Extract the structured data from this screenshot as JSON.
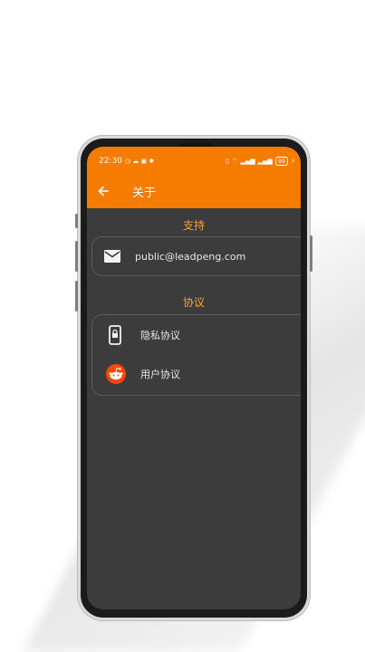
{
  "status_bar": {
    "time": "22:30",
    "battery": "99"
  },
  "toolbar": {
    "title": "关于",
    "back_icon": "arrow-left-icon"
  },
  "sections": [
    {
      "header": "支持",
      "items": [
        {
          "icon": "mail-icon",
          "label": "public@leadpeng.com"
        }
      ]
    },
    {
      "header": "协议",
      "items": [
        {
          "icon": "phone-lock-icon",
          "label": "隐私协议"
        },
        {
          "icon": "reddit-icon",
          "label": "用户协议"
        }
      ]
    }
  ],
  "colors": {
    "accent": "#f57c00",
    "section_header": "#f5a03a",
    "background": "#3c3c3c"
  }
}
